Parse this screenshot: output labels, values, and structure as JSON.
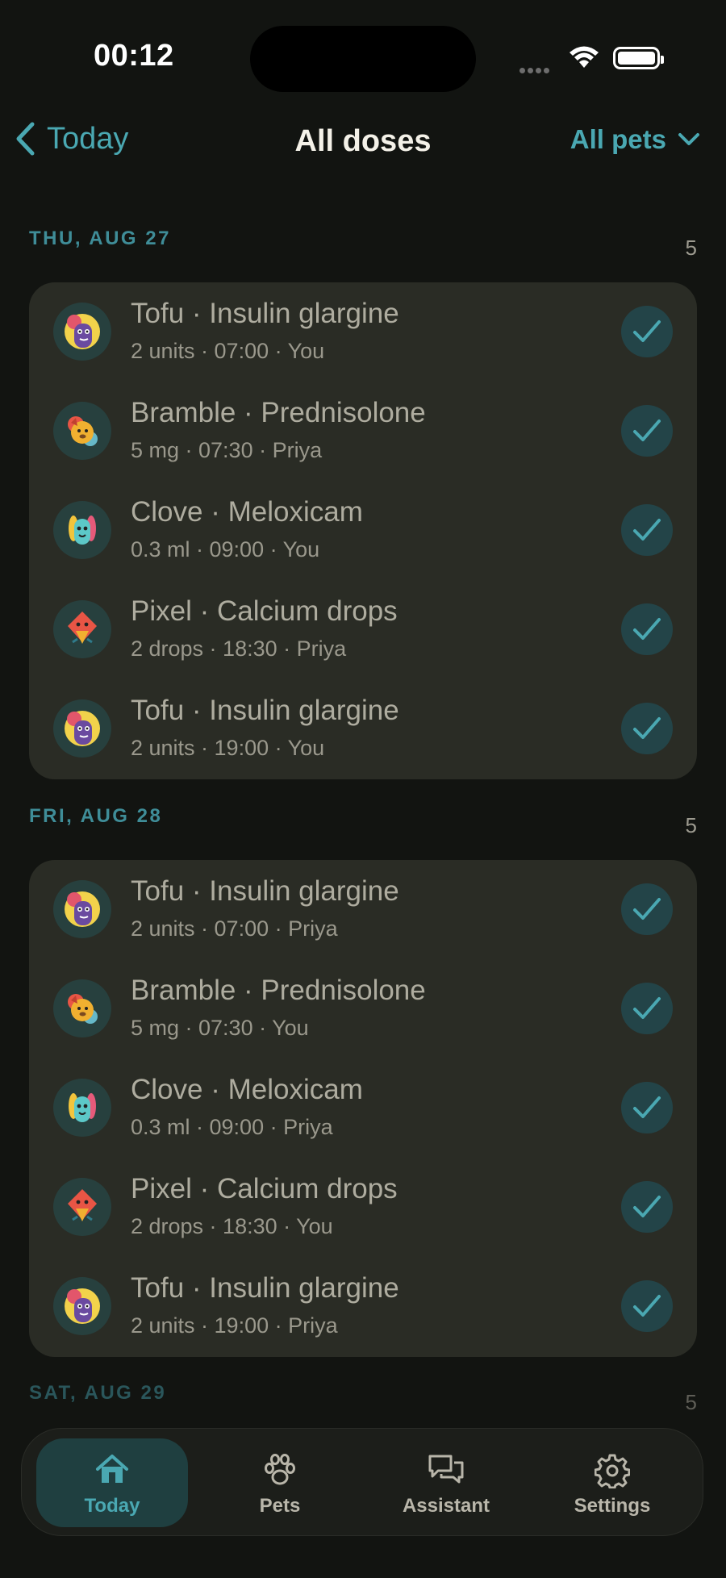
{
  "status_bar": {
    "time": "00:12"
  },
  "nav": {
    "back_label": "Today",
    "title": "All doses",
    "filter_label": "All pets"
  },
  "sections": [
    {
      "date": "THU, AUG 27",
      "count": "5",
      "doses": [
        {
          "title": "Tofu · Insulin glargine",
          "subtitle": "2 units · 07:00 · You",
          "pet": "tofu"
        },
        {
          "title": "Bramble · Prednisolone",
          "subtitle": "5 mg · 07:30 · Priya",
          "pet": "bramble"
        },
        {
          "title": "Clove · Meloxicam",
          "subtitle": "0.3 ml · 09:00 · You",
          "pet": "clove"
        },
        {
          "title": "Pixel · Calcium drops",
          "subtitle": "2 drops · 18:30 · Priya",
          "pet": "pixel"
        },
        {
          "title": "Tofu · Insulin glargine",
          "subtitle": "2 units · 19:00 · You",
          "pet": "tofu"
        }
      ]
    },
    {
      "date": "FRI, AUG 28",
      "count": "5",
      "doses": [
        {
          "title": "Tofu · Insulin glargine",
          "subtitle": "2 units · 07:00 · Priya",
          "pet": "tofu"
        },
        {
          "title": "Bramble · Prednisolone",
          "subtitle": "5 mg · 07:30 · You",
          "pet": "bramble"
        },
        {
          "title": "Clove · Meloxicam",
          "subtitle": "0.3 ml · 09:00 · Priya",
          "pet": "clove"
        },
        {
          "title": "Pixel · Calcium drops",
          "subtitle": "2 drops · 18:30 · You",
          "pet": "pixel"
        },
        {
          "title": "Tofu · Insulin glargine",
          "subtitle": "2 units · 19:00 · Priya",
          "pet": "tofu"
        }
      ]
    },
    {
      "date": "SAT, AUG 29",
      "count": "5"
    }
  ],
  "tabs": [
    {
      "label": "Today",
      "icon": "home-icon",
      "active": true
    },
    {
      "label": "Pets",
      "icon": "paw-icon",
      "active": false
    },
    {
      "label": "Assistant",
      "icon": "chat-icon",
      "active": false
    },
    {
      "label": "Settings",
      "icon": "gear-icon",
      "active": false
    }
  ],
  "colors": {
    "accent": "#4aa8b2",
    "section_header": "#3f8d98",
    "card": "#2a2c25",
    "background": "#121411"
  }
}
